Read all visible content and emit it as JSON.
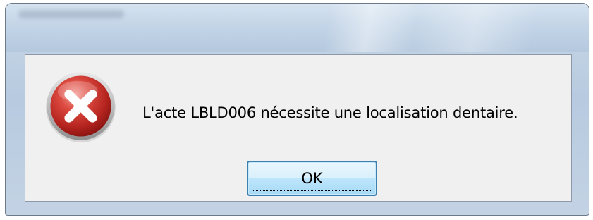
{
  "dialog": {
    "message": "L'acte LBLD006 nécessite une localisation dentaire.",
    "icon": "error-icon",
    "ok_label": "OK"
  },
  "colors": {
    "icon_red": "#c8322e",
    "button_border": "#3c7fb1",
    "content_bg": "#f0f0f0"
  }
}
